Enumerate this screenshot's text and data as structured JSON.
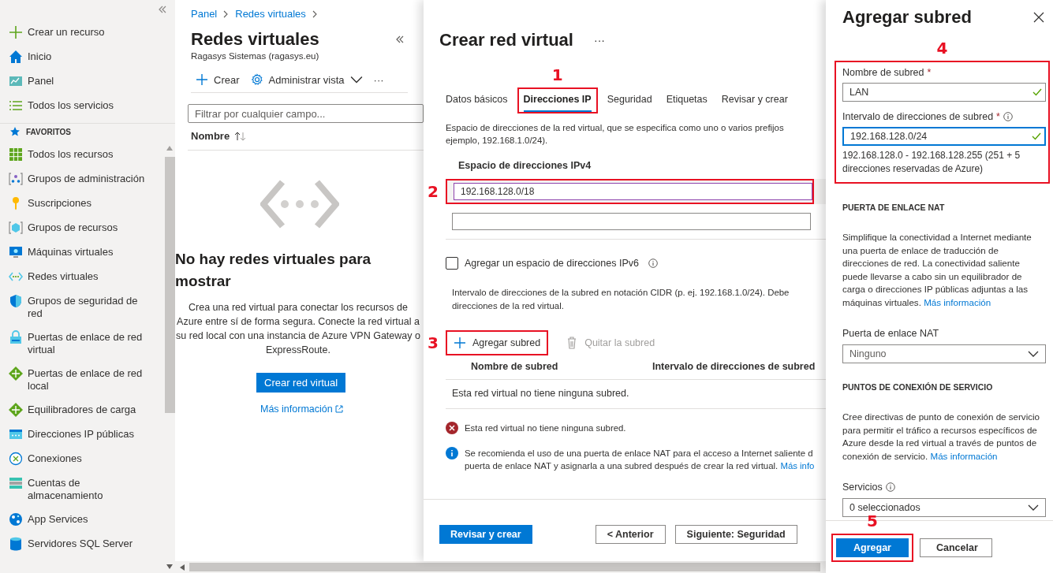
{
  "sidebar": {
    "top_items": [
      {
        "label": "Crear un recurso",
        "kind": "plus"
      },
      {
        "label": "Inicio",
        "kind": "home"
      },
      {
        "label": "Panel",
        "kind": "chart"
      },
      {
        "label": "Todos los servicios",
        "kind": "list"
      }
    ],
    "section_title": "FAVORITOS",
    "favorites": [
      {
        "label": "Todos los recursos",
        "kind": "grid"
      },
      {
        "label": "Grupos de administración",
        "kind": "hierarchy"
      },
      {
        "label": "Suscripciones",
        "kind": "key"
      },
      {
        "label": "Grupos de recursos",
        "kind": "cube"
      },
      {
        "label": "Máquinas virtuales",
        "kind": "monitor"
      },
      {
        "label": "Redes virtuales",
        "kind": "network"
      },
      {
        "label": "Grupos de seguridad de red",
        "kind": "shield"
      },
      {
        "label": "Puertas de enlace de red virtual",
        "kind": "lock"
      },
      {
        "label": "Puertas de enlace de red local",
        "kind": "diamond"
      },
      {
        "label": "Equilibradores de carga",
        "kind": "diamond"
      },
      {
        "label": "Direcciones IP públicas",
        "kind": "card"
      },
      {
        "label": "Conexiones",
        "kind": "circle"
      },
      {
        "label": "Cuentas de almacenamiento",
        "kind": "stack"
      },
      {
        "label": "App Services",
        "kind": "globe"
      },
      {
        "label": "Servidores SQL Server",
        "kind": "database"
      }
    ]
  },
  "breadcrumb": [
    "Panel",
    "Redes virtuales"
  ],
  "blade": {
    "title": "Redes virtuales",
    "subtitle": "Ragasys Sistemas (ragasys.eu)",
    "toolbar": [
      {
        "label": "Crear",
        "kind": "create"
      },
      {
        "label": "Administrar vista",
        "kind": "view"
      },
      {
        "label": "···",
        "kind": "more"
      }
    ],
    "filter_placeholder": "Filtrar por cualquier campo...",
    "column": "Nombre",
    "empty_title": "No hay redes virtuales para mostrar",
    "empty_text": "Crea una red virtual para conectar los recursos de Azure entre sí de forma segura. Conecte la red virtual a su red local con una instancia de Azure VPN Gateway o ExpressRoute.",
    "button": "Crear red virtual",
    "link": "Más información"
  },
  "create_panel": {
    "title": "Crear red virtual",
    "title_menu": "···",
    "tabs": [
      {
        "label": "Datos básicos",
        "selected": false
      },
      {
        "label": "Direcciones IP",
        "selected": true,
        "annotation": "1"
      },
      {
        "label": "Seguridad",
        "selected": false
      },
      {
        "label": "Etiquetas",
        "selected": false
      },
      {
        "label": "Revisar y crear",
        "selected": false
      }
    ],
    "description": [
      "Espacio de direcciones de la red virtual, que se especifica como uno o varios prefijos",
      "ejemplo, 192.168.1.0/24)."
    ],
    "ipv4_label": "Espacio de direcciones IPv4",
    "ipv4_fields": [
      {
        "value": "192.168.128.0/18",
        "focused": true,
        "annotation": "2"
      },
      {
        "focused": false
      }
    ],
    "ipv6": {
      "label": "Agregar un espacio de direcciones IPv6",
      "checked": false
    },
    "subnet_description": [
      "Intervalo de direcciones de la subred en notación CIDR (p. ej. 192.168.1.0/24). Debe",
      "direcciones de la red virtual."
    ],
    "actions": [
      {
        "label": "Agregar subred",
        "kind": "add",
        "disabled": false,
        "annotation": "3"
      },
      {
        "label": "Quitar la subred",
        "kind": "delete",
        "disabled": true
      }
    ],
    "table": {
      "columns": [
        "Nombre de subred",
        "Intervalo de direcciones de subred"
      ],
      "empty_text": "Esta red virtual no tiene ninguna subred."
    },
    "messages": [
      {
        "kind": "error",
        "lines": [
          "Esta red virtual no tiene ninguna subred."
        ]
      },
      {
        "kind": "info",
        "lines": [
          "Se recomienda el uso de una puerta de enlace NAT para el acceso a Internet saliente d",
          "puerta de enlace NAT y asignarla a una subred después de crear la red virtual."
        ],
        "link": "Más info"
      }
    ],
    "footer_buttons": [
      {
        "label": "Revisar y crear",
        "kind": "primary"
      },
      {
        "label": "< Anterior",
        "kind": "secondary"
      },
      {
        "label": "Siguiente: Seguridad",
        "kind": "secondary"
      }
    ]
  },
  "subnet_panel": {
    "title": "Agregar subred",
    "annotation": "4",
    "fields": [
      {
        "label": "Nombre de subred",
        "required_mark": "*",
        "info": false,
        "value": "LAN",
        "focused": false,
        "valid": true
      },
      {
        "label": "Intervalo de direcciones de subred",
        "required_mark": "*",
        "info": true,
        "value": "192.168.128.0/24",
        "focused": true,
        "valid": true,
        "hint": "192.168.128.0 - 192.168.128.255 (251 + 5 direcciones reservadas de Azure)"
      }
    ],
    "sections": [
      {
        "heading": "PUERTA DE ENLACE NAT",
        "text": "Simplifique la conectividad a Internet mediante una puerta de enlace de traducción de direcciones de red. La conectividad saliente puede llevarse a cabo sin un equilibrador de carga o direcciones IP públicas adjuntas a las máquinas virtuales.",
        "link": "Más información",
        "select_label": "Puerta de enlace NAT",
        "select_info": false,
        "select_value": "Ninguno",
        "select_placeholder": true
      },
      {
        "heading": "PUNTOS DE CONEXIÓN DE SERVICIO",
        "text": "Cree directivas de punto de conexión de servicio para permitir el tráfico a recursos específicos de Azure desde la red virtual a través de puntos de conexión de servicio.",
        "link": "Más información",
        "select_label": "Servicios",
        "select_info": true,
        "select_value": "0 seleccionados",
        "select_placeholder": false
      }
    ],
    "buttons": [
      {
        "label": "Agregar",
        "kind": "primary",
        "annotation": "5"
      },
      {
        "label": "Cancelar",
        "kind": "secondary"
      }
    ]
  }
}
